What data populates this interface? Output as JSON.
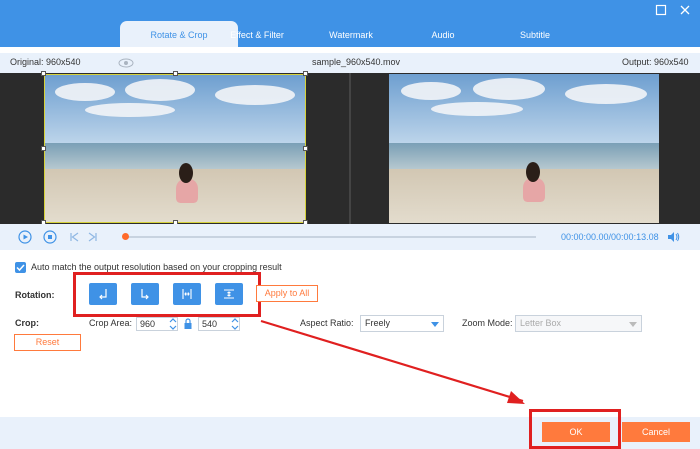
{
  "tabs": [
    {
      "label": "Rotate & Crop",
      "active": true
    },
    {
      "label": "Effect & Filter",
      "active": false
    },
    {
      "label": "Watermark",
      "active": false
    },
    {
      "label": "Audio",
      "active": false
    },
    {
      "label": "Subtitle",
      "active": false
    }
  ],
  "info": {
    "original": "Original: 960x540",
    "filename": "sample_960x540.mov",
    "output": "Output: 960x540"
  },
  "player": {
    "time": "00:00:00.00/00:00:13.08",
    "progress": 0.0
  },
  "settings": {
    "auto_match": "Auto match the output resolution based on your cropping result",
    "auto_match_checked": true,
    "rotation_label": "Rotation:",
    "apply_all": "Apply to All",
    "crop_label": "Crop:",
    "crop_area_label": "Crop Area:",
    "crop_width": "960",
    "crop_height": "540",
    "aspect_label": "Aspect Ratio:",
    "aspect_value": "Freely",
    "zoom_label": "Zoom Mode:",
    "zoom_value": "Letter Box",
    "reset": "Reset"
  },
  "footer": {
    "ok": "OK",
    "cancel": "Cancel"
  },
  "colors": {
    "brand": "#3f92e6",
    "accent": "#ff7a3d",
    "highlight": "#e02020"
  }
}
